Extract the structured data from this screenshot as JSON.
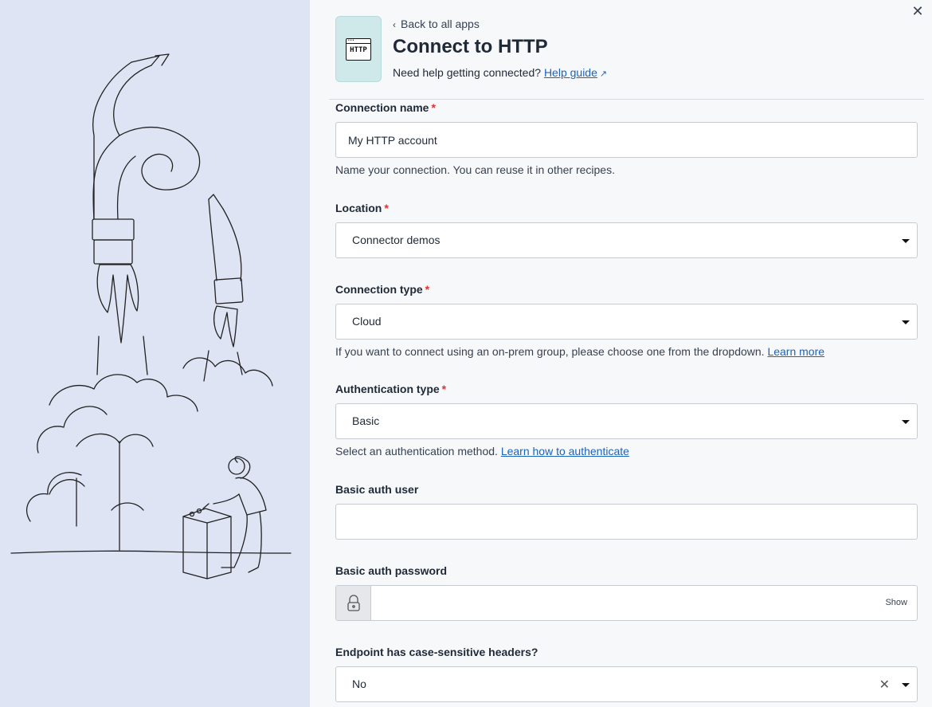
{
  "close": {
    "glyph": "✕"
  },
  "app": {
    "icon_text": "HTTP",
    "icon": "http-window-icon"
  },
  "header": {
    "back_label": "Back to all apps",
    "title": "Connect to HTTP",
    "help_prefix": "Need help getting connected?",
    "help_link": "Help guide"
  },
  "fields": {
    "connection_name": {
      "label": "Connection name",
      "value": "My HTTP account",
      "hint": "Name your connection. You can reuse it in other recipes."
    },
    "location": {
      "label": "Location",
      "value": "Connector demos"
    },
    "connection_type": {
      "label": "Connection type",
      "value": "Cloud",
      "hint": "If you want to connect using an on-prem group, please choose one from the dropdown.",
      "hint_link": "Learn more"
    },
    "auth_type": {
      "label": "Authentication type",
      "value": "Basic",
      "hint": "Select an authentication method.",
      "hint_link": "Learn how to authenticate"
    },
    "basic_user": {
      "label": "Basic auth user",
      "value": ""
    },
    "basic_password": {
      "label": "Basic auth password",
      "value": "",
      "show_label": "Show"
    },
    "case_sensitive": {
      "label": "Endpoint has case-sensitive headers?",
      "value": "No"
    }
  },
  "required_marker": "*",
  "colors": {
    "left_bg": "#dfe4f5",
    "right_bg": "#f7f8fa",
    "link": "#1d63b8",
    "required": "#dd3333",
    "icon_bg": "#cfe8ea"
  }
}
